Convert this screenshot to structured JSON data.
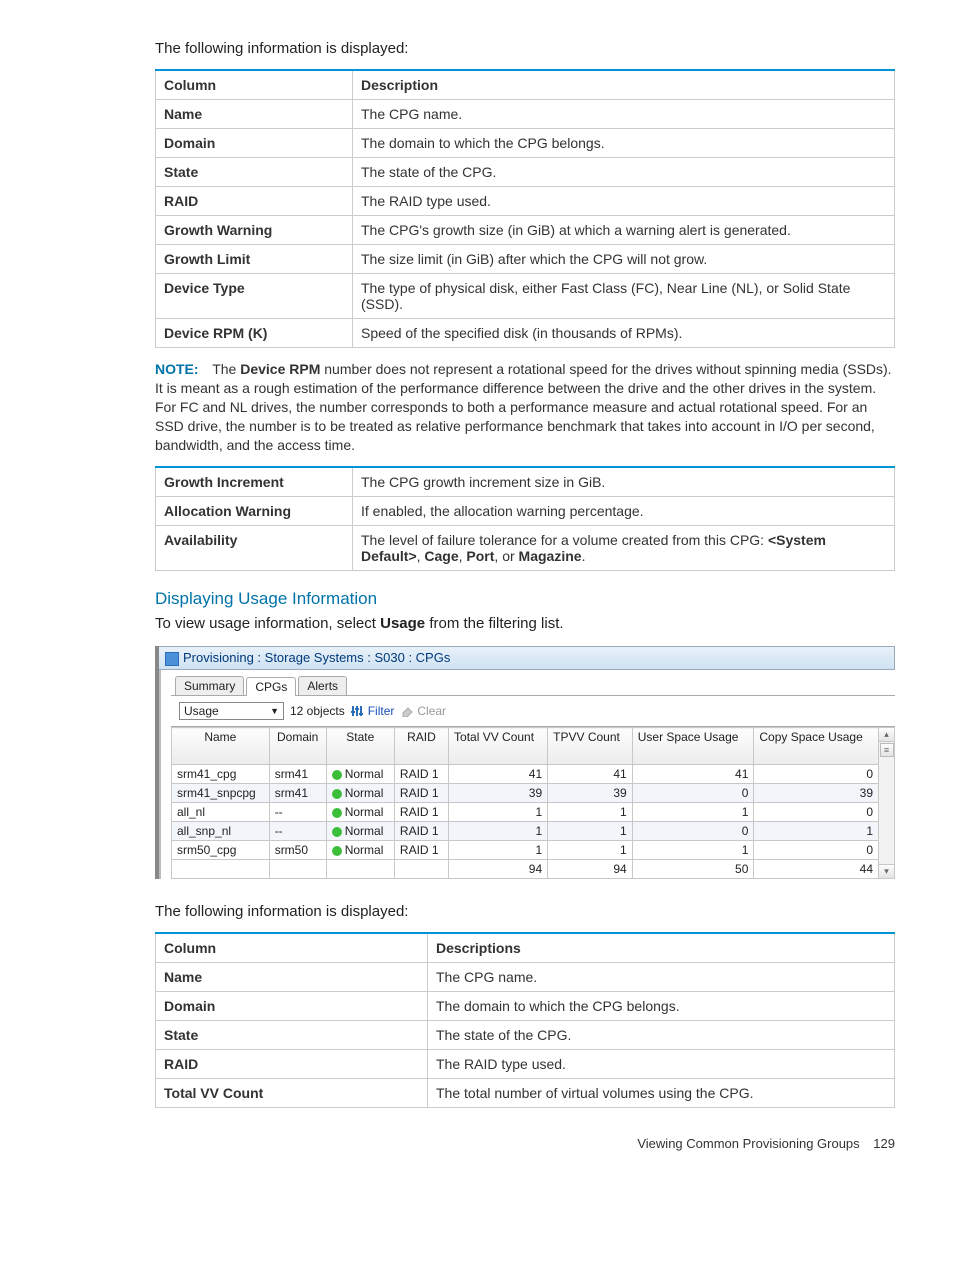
{
  "intro1": "The following information is displayed:",
  "table1_headers": [
    "Column",
    "Description"
  ],
  "table1_rows": [
    [
      "Name",
      "The CPG name."
    ],
    [
      "Domain",
      "The domain to which the CPG belongs."
    ],
    [
      "State",
      "The state of the CPG."
    ],
    [
      "RAID",
      "The RAID type used."
    ],
    [
      "Growth Warning",
      "The CPG's growth size (in GiB) at which a warning alert is generated."
    ],
    [
      "Growth Limit",
      "The size limit (in GiB) after which the CPG will not grow."
    ],
    [
      "Device Type",
      "The type of physical disk, either Fast Class (FC), Near Line (NL), or Solid State (SSD)."
    ],
    [
      "Device RPM (K)",
      "Speed of the specified disk (in thousands of RPMs)."
    ]
  ],
  "note_label": "NOTE:",
  "note_prefix": "The ",
  "note_bold1": "Device RPM",
  "note_rest": " number does not represent a rotational speed for the drives without spinning media (SSDs). It is meant as a rough estimation of the performance difference between the drive and the other drives in the system. For FC and NL drives, the number corresponds to both a performance measure and actual rotational speed. For an SSD drive, the number is to be treated as relative performance benchmark that takes into account in I/O per second, bandwidth, and the access time.",
  "table2_rows": [
    [
      "Growth Increment",
      "The CPG growth increment size in GiB."
    ],
    [
      "Allocation Warning",
      "If enabled, the allocation warning percentage."
    ]
  ],
  "avail_col": "Availability",
  "avail_pre": "The level of failure tolerance for a volume created from this CPG: ",
  "avail_b1": "<System Default>",
  "avail_c1": ", ",
  "avail_b2": "Cage",
  "avail_c2": ", ",
  "avail_b3": "Port",
  "avail_c3": ", or ",
  "avail_b4": "Magazine",
  "avail_c4": ".",
  "subheading": "Displaying Usage Information",
  "usage_pre": "To view usage information, select ",
  "usage_bold": "Usage",
  "usage_post": " from the filtering list.",
  "ss_title": "Provisioning : Storage Systems : S030 : CPGs",
  "tabs": {
    "summary": "Summary",
    "cpgs": "CPGs",
    "alerts": "Alerts"
  },
  "toolbar": {
    "dropdown": "Usage",
    "count": "12 objects",
    "filter": "Filter",
    "clear": "Clear"
  },
  "grid_headers": [
    "Name",
    "Domain",
    "State",
    "RAID",
    "Total VV Count",
    "TPVV Count",
    "User Space Usage",
    "Copy Space Usage"
  ],
  "chart_data": {
    "type": "table",
    "columns": [
      "Name",
      "Domain",
      "State",
      "RAID",
      "Total VV Count",
      "TPVV Count",
      "User Space Usage",
      "Copy Space Usage"
    ],
    "rows": [
      [
        "srm41_cpg",
        "srm41",
        "Normal",
        "RAID 1",
        41,
        41,
        41,
        0
      ],
      [
        "srm41_snpcpg",
        "srm41",
        "Normal",
        "RAID 1",
        39,
        39,
        0,
        39
      ],
      [
        "all_nl",
        "--",
        "Normal",
        "RAID 1",
        1,
        1,
        1,
        0
      ],
      [
        "all_snp_nl",
        "--",
        "Normal",
        "RAID 1",
        1,
        1,
        0,
        1
      ],
      [
        "srm50_cpg",
        "srm50",
        "Normal",
        "RAID 1",
        1,
        1,
        1,
        0
      ]
    ],
    "totals": {
      "Total VV Count": 94,
      "TPVV Count": 94,
      "User Space Usage": 50,
      "Copy Space Usage": 44
    }
  },
  "intro2": "The following information is displayed:",
  "table3_headers": [
    "Column",
    "Descriptions"
  ],
  "table3_rows": [
    [
      "Name",
      "The CPG name."
    ],
    [
      "Domain",
      "The domain to which the CPG belongs."
    ],
    [
      "State",
      "The state of the CPG."
    ],
    [
      "RAID",
      "The RAID type used."
    ],
    [
      "Total VV Count",
      "The total number of virtual volumes using the CPG."
    ]
  ],
  "footer_text": "Viewing Common Provisioning Groups",
  "footer_page": "129"
}
